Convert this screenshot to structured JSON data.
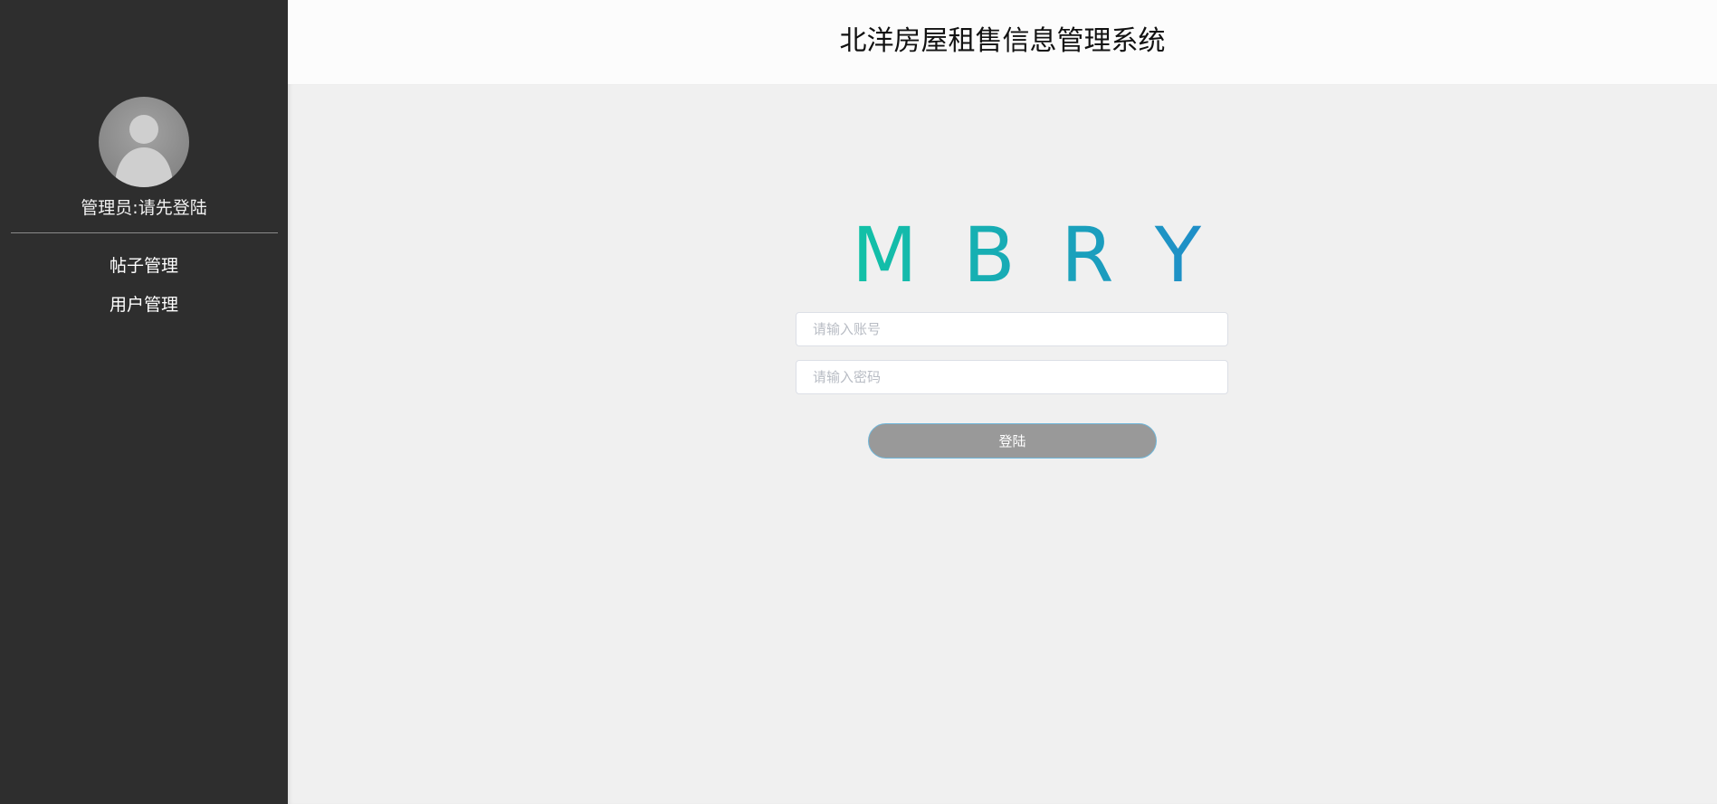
{
  "header": {
    "title": "北洋房屋租售信息管理系统"
  },
  "sidebar": {
    "avatar_icon": "user-avatar-icon",
    "admin_label": "管理员:请先登陆",
    "items": [
      {
        "label": "帖子管理"
      },
      {
        "label": "用户管理"
      }
    ]
  },
  "login": {
    "logo_text": "MBRY",
    "logo_colors": [
      "#12c2a6",
      "#1f8ec8"
    ],
    "account_placeholder": "请输入账号",
    "account_value": "",
    "password_placeholder": "请输入密码",
    "password_value": "",
    "submit_label": "登陆"
  },
  "colors": {
    "sidebar_bg": "#2e2e2e",
    "header_bg": "#fcfcfc",
    "main_bg": "#f0f0f0",
    "button_bg": "#999999",
    "button_border": "#6fb6d9"
  }
}
